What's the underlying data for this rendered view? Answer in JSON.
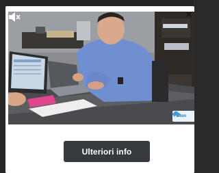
{
  "ad": {
    "close_glyph": "✕",
    "cta_label": "Ulteriori info",
    "brand_label": "Falton",
    "video_scene_icons": [
      "mute-icon",
      "cloud-logo-icon"
    ]
  },
  "colors": {
    "cta_background": "#36393e",
    "cta_text": "#ffffff",
    "card_background": "#ffffff",
    "page_background": "#2a2a2a",
    "brand_accent": "#1a6fb6"
  }
}
